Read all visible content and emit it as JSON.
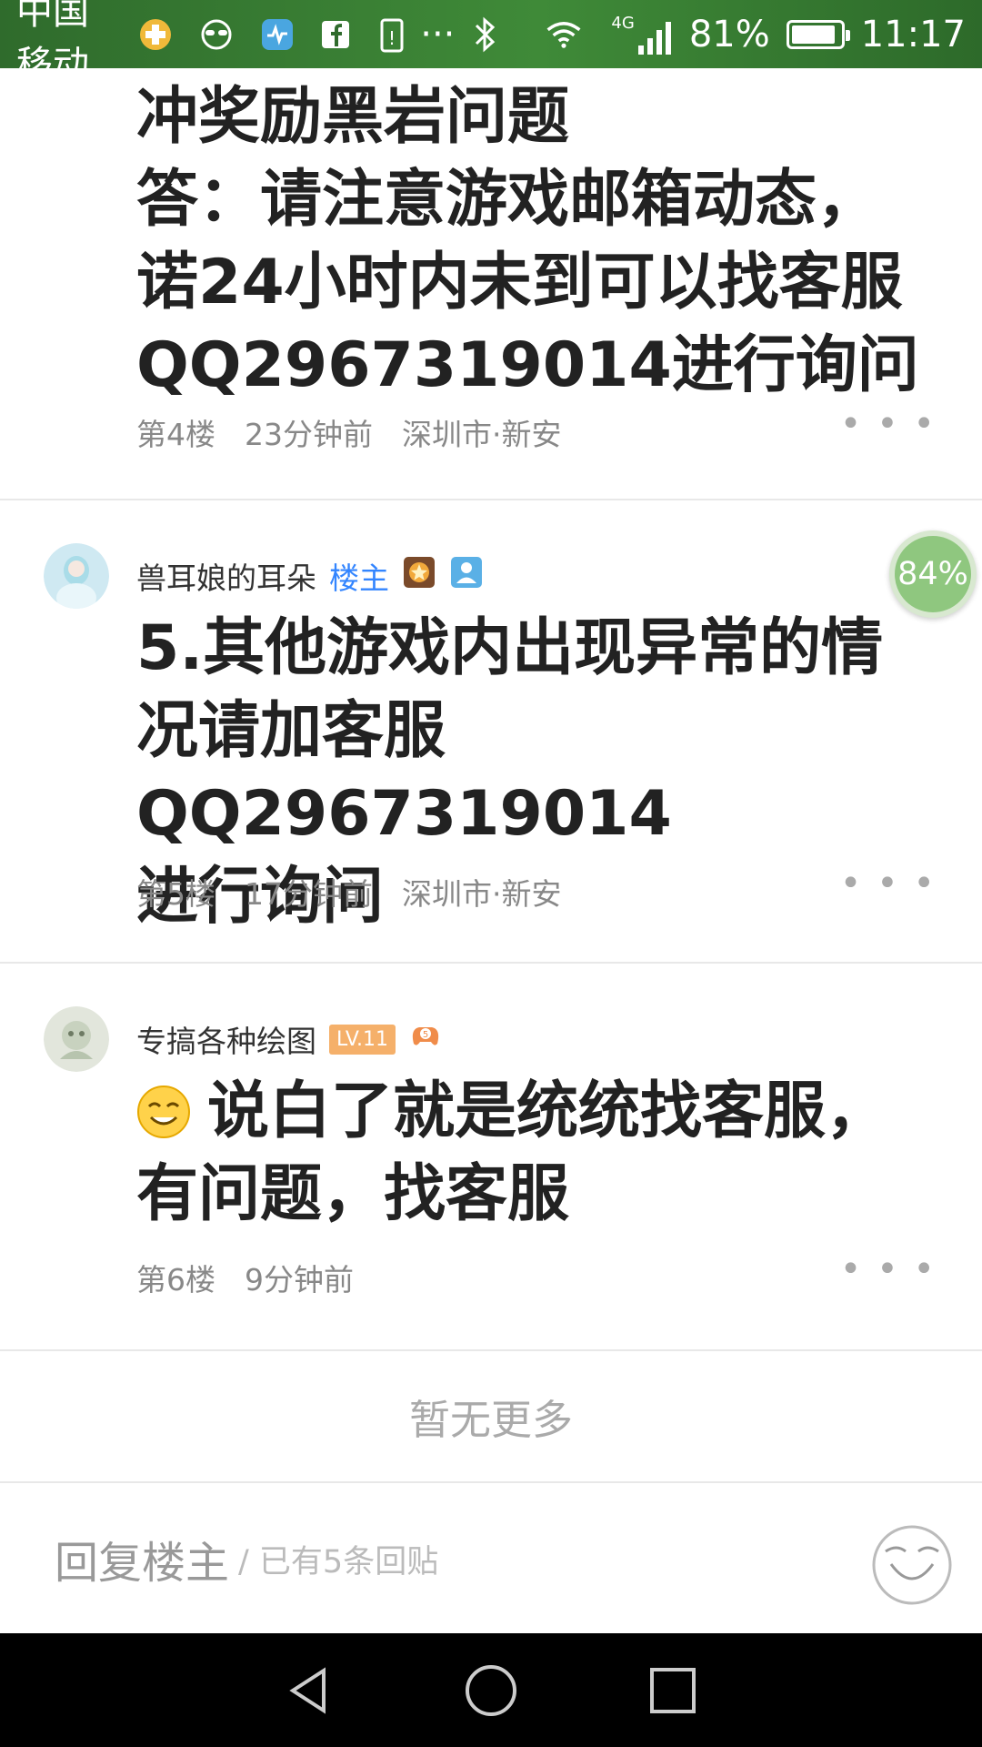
{
  "status_bar": {
    "carrier": "中国移动",
    "network": "4G",
    "battery_percent": "81%",
    "time": "11:17",
    "more": "···"
  },
  "posts": [
    {
      "floor": "第4楼",
      "time": "23分钟前",
      "location": "深圳市·新安",
      "lines": [
        "冲奖励黑岩问题",
        "答：请注意游戏邮箱动态，",
        "诺24小时内未到可以找客服",
        "QQ2967319014进行询问"
      ]
    },
    {
      "username": "兽耳娘的耳朵",
      "badge": "楼主",
      "floor": "第5楼",
      "time": "17分钟前",
      "location": "深圳市·新安",
      "lines": [
        "5.其他游戏内出现异常的情",
        "况请加客服QQ2967319014",
        "进行询问"
      ]
    },
    {
      "username": "专搞各种绘图",
      "level": "LV.11",
      "floor": "第6楼",
      "time": "9分钟前",
      "lines": [
        "说白了就是统统找客服，",
        "有问题，找客服"
      ]
    }
  ],
  "progress_bubble": "84%",
  "no_more": "暂无更多",
  "reply": {
    "label": "回复楼主",
    "sub": "/ 已有5条回贴"
  },
  "colors": {
    "status_bar_green": "#3f8a38",
    "owner_badge_blue": "#3385ff",
    "level_badge_orange": "#f5b06a"
  }
}
